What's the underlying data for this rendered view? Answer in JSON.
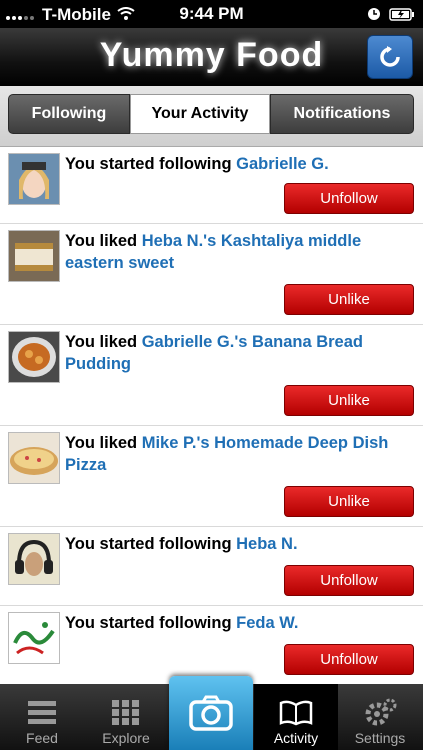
{
  "status": {
    "carrier": "T-Mobile",
    "time": "9:44 PM"
  },
  "nav": {
    "title": "Yummy Food"
  },
  "tabs": [
    {
      "label": "Following",
      "active": false
    },
    {
      "label": "Your Activity",
      "active": true
    },
    {
      "label": "Notifications",
      "active": false
    }
  ],
  "activity": [
    {
      "prefix": "You started following ",
      "link": "Gabrielle G.",
      "button": "Unfollow"
    },
    {
      "prefix": "You liked ",
      "link": "Heba N.'s Kashtaliya middle eastern sweet",
      "button": "Unlike"
    },
    {
      "prefix": "You liked ",
      "link": "Gabrielle G.'s Banana Bread Pudding",
      "button": "Unlike"
    },
    {
      "prefix": "You liked ",
      "link": "Mike P.'s Homemade Deep Dish Pizza",
      "button": "Unlike"
    },
    {
      "prefix": "You started following ",
      "link": "Heba N.",
      "button": "Unfollow"
    },
    {
      "prefix": "You started following ",
      "link": "Feda W.",
      "button": "Unfollow"
    }
  ],
  "tabbar": [
    {
      "label": "Feed",
      "icon": "list-icon"
    },
    {
      "label": "Explore",
      "icon": "grid-icon"
    },
    {
      "label": "Activity",
      "icon": "book-icon",
      "active": true
    },
    {
      "label": "Settings",
      "icon": "gear-icon"
    }
  ],
  "colors": {
    "accent": "#1f6fb5",
    "button_red": "#d41a1a",
    "camera_blue": "#2a98d4"
  }
}
